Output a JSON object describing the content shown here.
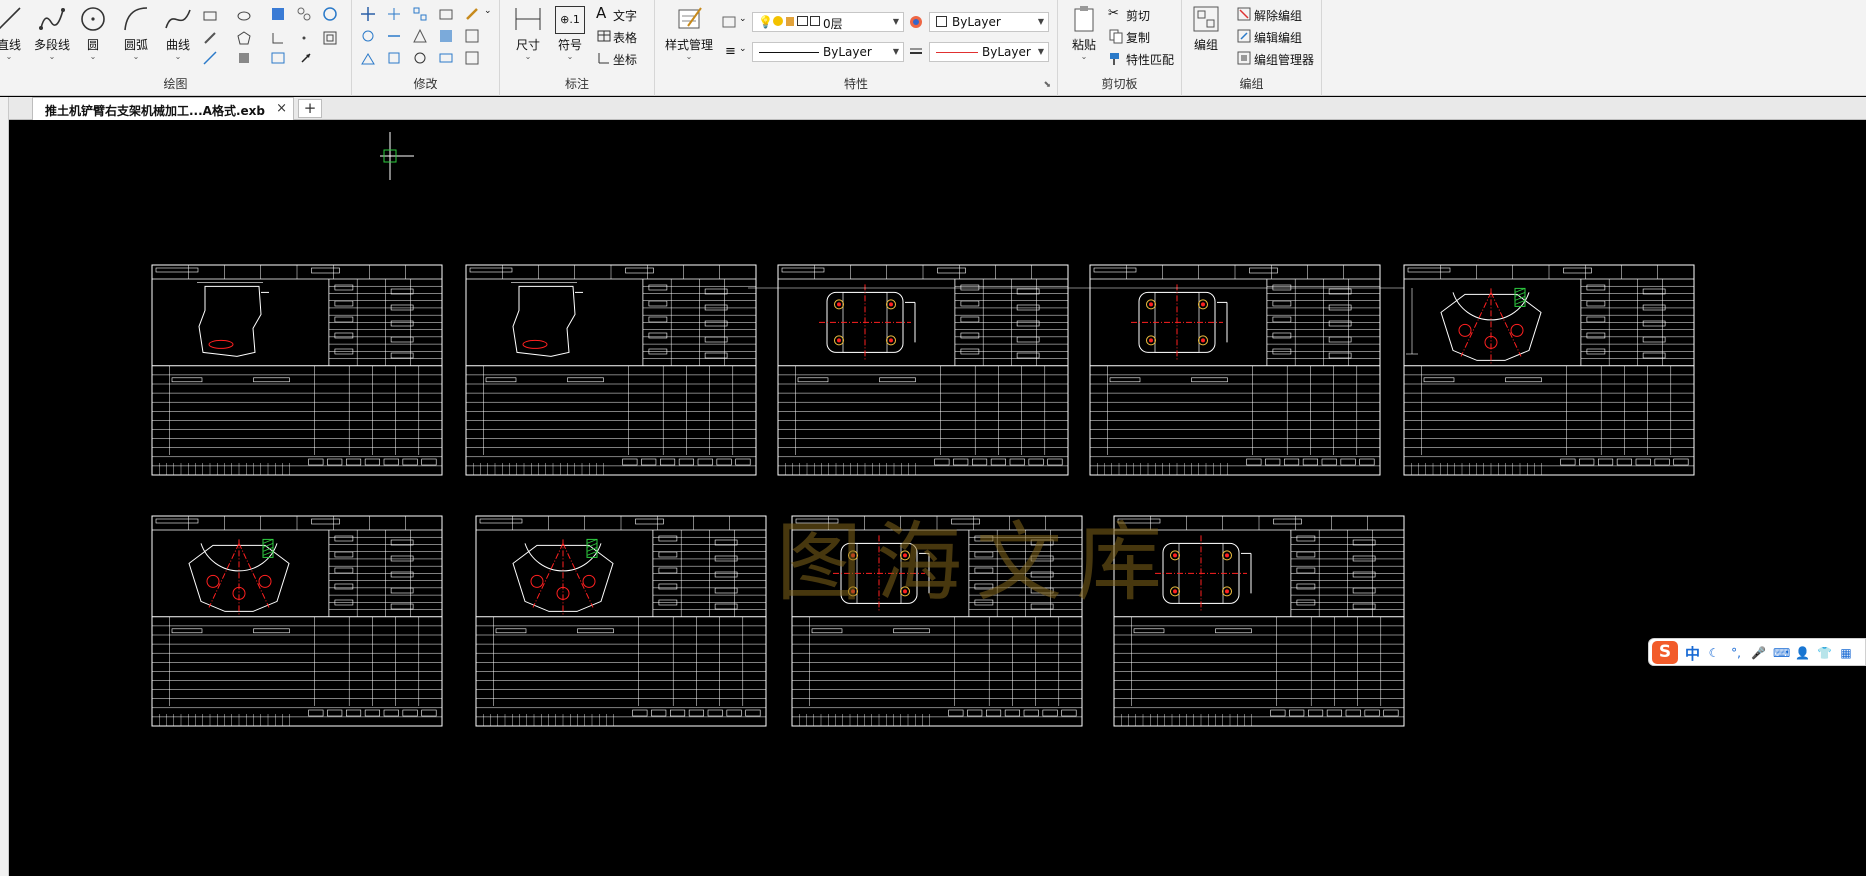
{
  "ribbon": {
    "draw": {
      "label": "绘图",
      "tools": [
        {
          "label": "直线"
        },
        {
          "label": "多段线"
        },
        {
          "label": "圆"
        },
        {
          "label": "圆弧"
        },
        {
          "label": "曲线"
        }
      ]
    },
    "modify": {
      "label": "修改"
    },
    "annotate": {
      "label": "标注",
      "dimension": "尺寸",
      "symbol": "符号",
      "symbol_glyph": "⊕.1",
      "text": "文字",
      "table": "表格",
      "coordinate": "坐标"
    },
    "properties": {
      "label": "特性",
      "style_manager": "样式管理",
      "layer_value": "0层",
      "color_value": "ByLayer",
      "linetype_value": "ByLayer",
      "lineweight_value": "ByLayer"
    },
    "clipboard": {
      "label": "剪切板",
      "paste": "粘贴",
      "cut": "剪切",
      "copy": "复制",
      "match_props": "特性匹配"
    },
    "group": {
      "label": "编组",
      "group": "编组",
      "ungroup": "解除编组",
      "edit_group": "编辑编组",
      "group_manager": "编组管理器"
    }
  },
  "tabs": {
    "active_doc": "推土机铲臂右支架机械加工...A格式.exb",
    "close_glyph": "×",
    "new_tab_glyph": "+"
  },
  "canvas": {
    "watermark": "图海文库",
    "sheets_row1": [
      {
        "part": "bracket"
      },
      {
        "part": "bracket"
      },
      {
        "part": "plate"
      },
      {
        "part": "plate"
      },
      {
        "part": "fan"
      }
    ],
    "sheets_row2": [
      {
        "part": "fan"
      },
      {
        "part": "fan"
      },
      {
        "part": "plate"
      },
      {
        "part": "plate"
      }
    ]
  },
  "ime": {
    "logo": "S",
    "lang": "中"
  },
  "colors": {
    "ribbon_bg": "#f3f3f3",
    "canvas_bg": "#000000",
    "sheet_line": "#ffffff",
    "center_line": "#ff2020",
    "hole_mark": "#ff2020",
    "hatch": "#2ecc40",
    "ime_accent": "#1769d4",
    "ime_logo": "#f25b2a"
  }
}
